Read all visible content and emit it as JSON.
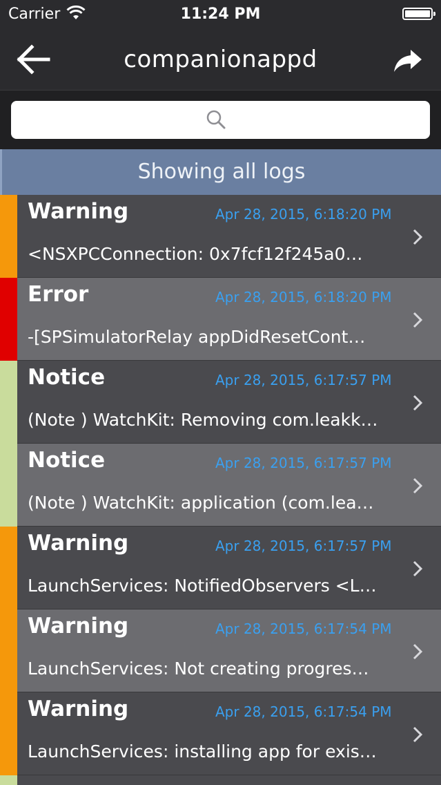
{
  "status_bar": {
    "carrier": "Carrier",
    "time": "11:24 PM",
    "wifi_icon": "wifi-icon",
    "battery_icon": "battery-icon"
  },
  "nav": {
    "title": "companionappd",
    "back_icon": "back-arrow-icon",
    "share_icon": "share-icon"
  },
  "search": {
    "placeholder": "",
    "value": "",
    "icon": "search-icon"
  },
  "banner": {
    "text": "Showing all logs"
  },
  "colors": {
    "warning": "#f5980b",
    "error": "#e00000",
    "notice": "#c9dc9c",
    "timestamp": "#3aa0f0",
    "banner": "#6a7fa1"
  },
  "logs": [
    {
      "level": "Warning",
      "timestamp": "Apr 28, 2015, 6:18:20 PM",
      "message": "<NSXPCConnection: 0x7fcf12f245a0…"
    },
    {
      "level": "Error",
      "timestamp": "Apr 28, 2015, 6:18:20 PM",
      "message": "-[SPSimulatorRelay appDidResetCont…"
    },
    {
      "level": "Notice",
      "timestamp": "Apr 28, 2015, 6:17:57 PM",
      "message": "(Note ) WatchKit: Removing com.leakk…"
    },
    {
      "level": "Notice",
      "timestamp": "Apr 28, 2015, 6:17:57 PM",
      "message": "(Note ) WatchKit: application (com.lea…"
    },
    {
      "level": "Warning",
      "timestamp": "Apr 28, 2015, 6:17:57 PM",
      "message": "LaunchServices: NotifiedObservers <L…"
    },
    {
      "level": "Warning",
      "timestamp": "Apr 28, 2015, 6:17:54 PM",
      "message": "LaunchServices: Not creating progres…"
    },
    {
      "level": "Warning",
      "timestamp": "Apr 28, 2015, 6:17:54 PM",
      "message": "LaunchServices: installing app for exis…"
    }
  ]
}
